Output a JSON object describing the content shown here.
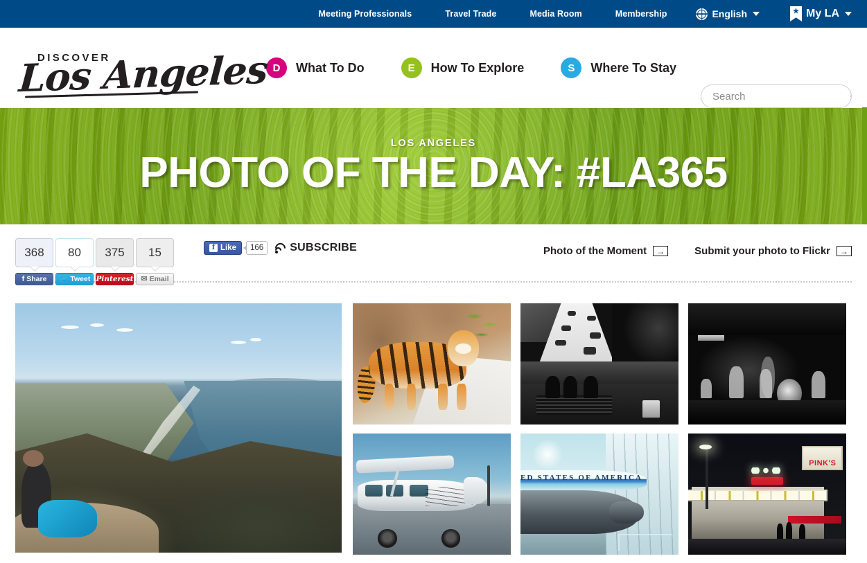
{
  "topbar": {
    "links": [
      {
        "label": "Meeting Professionals"
      },
      {
        "label": "Travel Trade"
      },
      {
        "label": "Media Room"
      },
      {
        "label": "Membership"
      }
    ],
    "language": {
      "label": "English",
      "icon": "globe-icon"
    },
    "myla": {
      "label": "My LA",
      "icon": "bookmark-star-icon"
    },
    "bg_color": "#004B87"
  },
  "header": {
    "logo": {
      "eyebrow": "DISCOVER",
      "script": "Los Angeles"
    },
    "nav": [
      {
        "badge": "D",
        "label": "What To Do",
        "color": "#D6007F"
      },
      {
        "badge": "E",
        "label": "How To Explore",
        "color": "#95C11F"
      },
      {
        "badge": "S",
        "label": "Where To Stay",
        "color": "#29ABE2"
      }
    ],
    "search": {
      "placeholder": "Search",
      "value": "",
      "icon": "search-icon"
    }
  },
  "hero": {
    "kicker": "LOS ANGELES",
    "title": "PHOTO OF THE DAY: #LA365",
    "bg_color": "#85BD14"
  },
  "sharebar": {
    "counters": [
      {
        "count": "368",
        "label": "Share",
        "network": "facebook"
      },
      {
        "count": "80",
        "label": "Tweet",
        "network": "twitter"
      },
      {
        "count": "375",
        "label": "Pinterest",
        "network": "pinterest"
      },
      {
        "count": "15",
        "label": "Email",
        "network": "email"
      }
    ],
    "facebook_like": {
      "label": "Like",
      "count": "166"
    },
    "subscribe": {
      "label": "SUBSCRIBE",
      "icon": "rss-icon"
    },
    "right_links": [
      {
        "label": "Photo of the Moment",
        "icon": "arrow-right-icon"
      },
      {
        "label": "Submit your photo to Flickr",
        "icon": "arrow-right-icon"
      }
    ]
  },
  "gallery": {
    "featured": {
      "alt": "Coastal hillside view with hiker overlooking the Pacific"
    },
    "thumbs": [
      {
        "alt": "Tiger standing on snowy rocks"
      },
      {
        "alt": "Black and white street scene with people on a bench"
      },
      {
        "alt": "Black and white jazz band performing on a dark stage"
      },
      {
        "alt": "Signed Cessna airplane parked on the tarmac"
      },
      {
        "alt": "Air Force One on display inside a hangar"
      },
      {
        "alt": "Pink's Hot Dogs stand lit up at night"
      }
    ]
  }
}
